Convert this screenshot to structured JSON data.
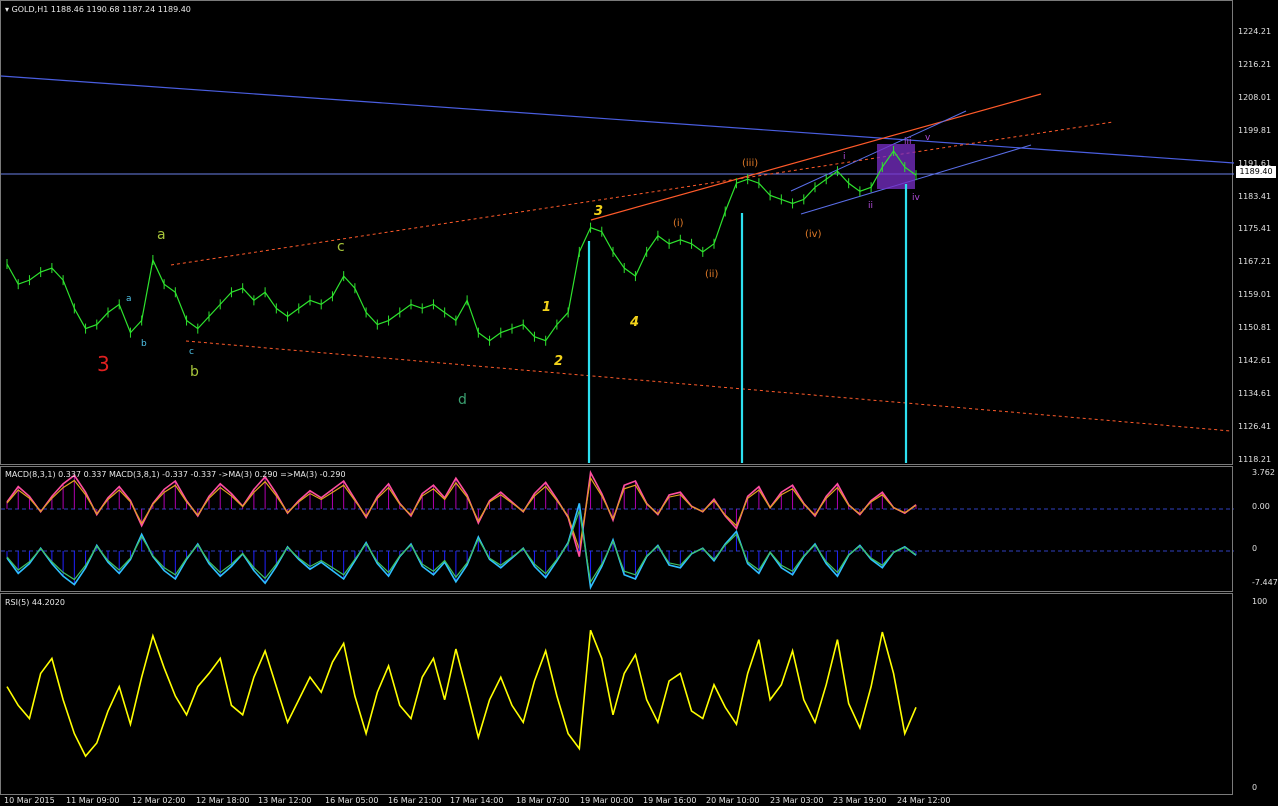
{
  "chart_data": [
    {
      "type": "line",
      "title": "GOLD,H1",
      "ohlc": {
        "open": "1188.46",
        "high": "1190.68",
        "low": "1187.24",
        "close": "1189.40"
      },
      "current_price": "1189.40",
      "y_ticks": [
        "1224.21",
        "1216.21",
        "1208.01",
        "1199.81",
        "1191.61",
        "1183.41",
        "1175.41",
        "1167.21",
        "1159.01",
        "1150.81",
        "1142.61",
        "1134.61",
        "1126.41",
        "1118.21"
      ],
      "x_ticks": [
        "10 Mar 2015",
        "11 Mar 09:00",
        "12 Mar 02:00",
        "12 Mar 18:00",
        "13 Mar 12:00",
        "16 Mar 05:00",
        "16 Mar 21:00",
        "17 Mar 14:00",
        "18 Mar 07:00",
        "19 Mar 00:00",
        "19 Mar 16:00",
        "20 Mar 10:00",
        "23 Mar 03:00",
        "23 Mar 19:00",
        "24 Mar 12:00"
      ],
      "ylim": [
        1118.21,
        1224.21
      ],
      "series": [
        {
          "values": [
            1167,
            1162,
            1163,
            1165,
            1166,
            1163,
            1156,
            1151,
            1152,
            1155,
            1157,
            1150,
            1153,
            1168,
            1162,
            1160,
            1153,
            1151,
            1154,
            1157,
            1160,
            1161,
            1158,
            1160,
            1156,
            1154,
            1156,
            1158,
            1157,
            1159,
            1164,
            1161,
            1155,
            1152,
            1153,
            1155,
            1157,
            1156,
            1157,
            1155,
            1153,
            1158,
            1150,
            1148,
            1150,
            1151,
            1152,
            1149,
            1148,
            1152,
            1155,
            1170,
            1176,
            1175,
            1170,
            1166,
            1164,
            1170,
            1174,
            1172,
            1173,
            1172,
            1170,
            1172,
            1180,
            1187,
            1188,
            1187,
            1184,
            1183,
            1182,
            1183,
            1186,
            1188,
            1190,
            1187,
            1185,
            1186,
            1191,
            1195,
            1191,
            1189
          ]
        }
      ],
      "annotations": [
        {
          "text": "3",
          "color": "#e02020"
        },
        {
          "text": "a",
          "color": "#a6c43a"
        },
        {
          "text": "b",
          "color": "#a6c43a"
        },
        {
          "text": "c",
          "color": "#a6c43a"
        },
        {
          "text": "d",
          "color": "#3aa070"
        },
        {
          "text": "1",
          "color": "#f2d21a"
        },
        {
          "text": "2",
          "color": "#f2d21a"
        },
        {
          "text": "3",
          "color": "#f2d21a"
        },
        {
          "text": "4",
          "color": "#f2d21a"
        },
        {
          "text": "(i)",
          "color": "#e07a28"
        },
        {
          "text": "(ii)",
          "color": "#e07a28"
        },
        {
          "text": "(iii)",
          "color": "#e07a28"
        },
        {
          "text": "(iv)",
          "color": "#e07a28"
        },
        {
          "text": "i",
          "color": "#b04bd8"
        },
        {
          "text": "ii",
          "color": "#b04bd8"
        },
        {
          "text": "iii",
          "color": "#b04bd8"
        },
        {
          "text": "iv",
          "color": "#b04bd8"
        },
        {
          "text": "v",
          "color": "#b04bd8"
        },
        {
          "text": "a",
          "color": "#4fc3e8"
        },
        {
          "text": "b",
          "color": "#4fc3e8"
        },
        {
          "text": "c",
          "color": "#4fc3e8"
        }
      ]
    },
    {
      "type": "line",
      "title": "MACD(8,3,1) 0.337 0.337  MACD(3,8,1) -0.337 -0.337  ->MA(3) 0.290  =>MA(3) -0.290",
      "y_ticks": [
        "3.762",
        "0.00",
        "0",
        "-7.447"
      ],
      "series": [
        {
          "name": "MACD(8,3,1)",
          "color": "#ff4fa0",
          "values": [
            0.5,
            1.6,
            0.9,
            -0.2,
            0.9,
            1.8,
            2.4,
            1.2,
            -0.4,
            0.8,
            1.6,
            0.6,
            -1.2,
            0.4,
            1.4,
            2.0,
            0.6,
            -0.5,
            0.9,
            1.8,
            1.1,
            0.2,
            1.4,
            2.3,
            1.1,
            -0.3,
            0.6,
            1.3,
            0.8,
            1.4,
            2.0,
            0.7,
            -0.6,
            0.9,
            1.8,
            0.4,
            -0.5,
            1.1,
            1.7,
            0.8,
            2.2,
            1.0,
            -1.0,
            0.6,
            1.2,
            0.5,
            -0.2,
            1.1,
            1.9,
            0.7,
            -0.6,
            -3.4,
            2.6,
            1.1,
            -0.8,
            1.7,
            2.0,
            0.4,
            -0.4,
            1.0,
            1.2,
            0.2,
            -0.2,
            0.7,
            -0.5,
            -1.4,
            0.9,
            1.6,
            0.1,
            1.2,
            1.7,
            0.4,
            -0.5,
            0.9,
            1.8,
            0.3,
            -0.4,
            0.6,
            1.2,
            0.1,
            -0.3,
            0.3
          ]
        },
        {
          "name": "MACD(3,8,1)",
          "color": "#2fc0ff",
          "values": [
            -0.5,
            -1.6,
            -0.9,
            0.2,
            -0.9,
            -1.8,
            -2.4,
            -1.2,
            0.4,
            -0.8,
            -1.6,
            -0.6,
            1.2,
            -0.4,
            -1.4,
            -2.0,
            -0.6,
            0.5,
            -0.9,
            -1.8,
            -1.1,
            -0.2,
            -1.4,
            -2.3,
            -1.1,
            0.3,
            -0.6,
            -1.3,
            -0.8,
            -1.4,
            -2.0,
            -0.7,
            0.6,
            -0.9,
            -1.8,
            -0.4,
            0.5,
            -1.1,
            -1.7,
            -0.8,
            -2.2,
            -1.0,
            1.0,
            -0.6,
            -1.2,
            -0.5,
            0.2,
            -1.1,
            -1.9,
            -0.7,
            0.6,
            3.4,
            -2.6,
            -1.1,
            0.8,
            -1.7,
            -2.0,
            -0.4,
            0.4,
            -1.0,
            -1.2,
            -0.2,
            0.2,
            -0.7,
            0.5,
            1.4,
            -0.9,
            -1.6,
            -0.1,
            -1.2,
            -1.7,
            -0.4,
            0.5,
            -0.9,
            -1.8,
            -0.3,
            0.4,
            -0.6,
            -1.2,
            -0.1,
            0.3,
            -0.3
          ]
        }
      ]
    },
    {
      "type": "line",
      "title": "RSI(5) 44.2020",
      "y_ticks": [
        "100",
        "0"
      ],
      "series": [
        {
          "name": "RSI(5)",
          "color": "#ffff00",
          "values": [
            55,
            45,
            38,
            62,
            70,
            48,
            30,
            18,
            25,
            42,
            55,
            35,
            60,
            82,
            65,
            50,
            40,
            55,
            62,
            70,
            45,
            40,
            60,
            74,
            55,
            36,
            48,
            60,
            52,
            68,
            78,
            50,
            30,
            52,
            66,
            45,
            38,
            60,
            70,
            48,
            75,
            52,
            28,
            48,
            60,
            45,
            36,
            58,
            74,
            50,
            30,
            22,
            85,
            70,
            40,
            62,
            72,
            48,
            36,
            58,
            62,
            42,
            38,
            56,
            44,
            35,
            62,
            80,
            48,
            56,
            74,
            48,
            36,
            56,
            80,
            46,
            33,
            55,
            84,
            62,
            30,
            44
          ]
        }
      ]
    }
  ]
}
